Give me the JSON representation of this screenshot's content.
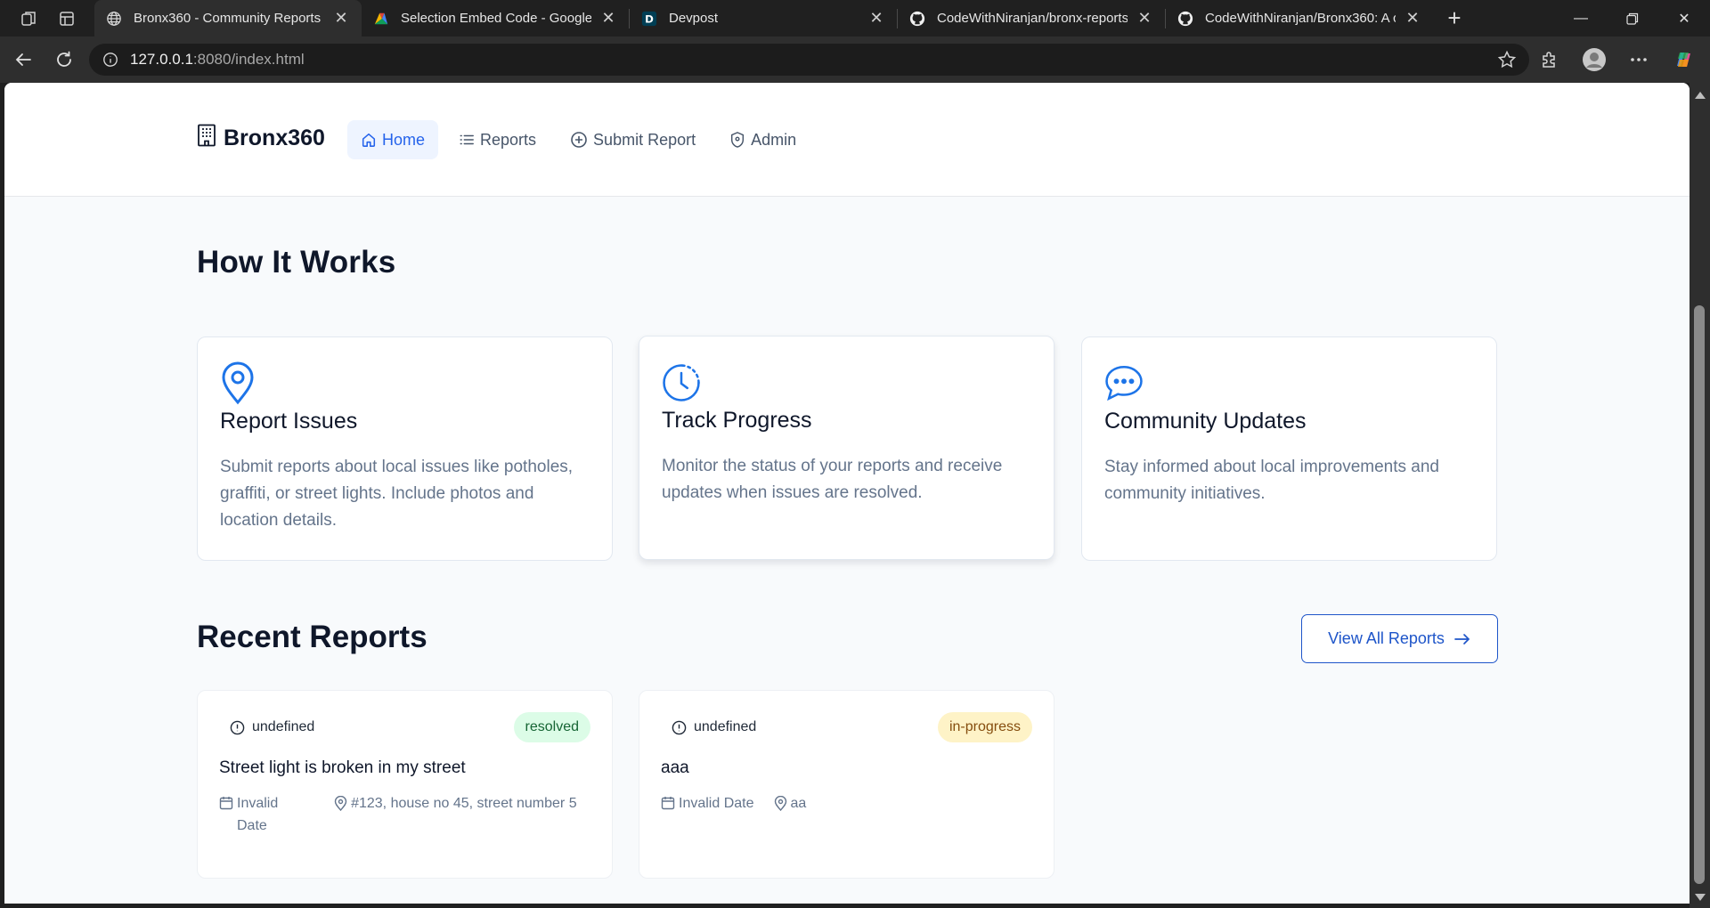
{
  "browser": {
    "tabs": [
      {
        "title": "Bronx360 - Community Reports",
        "favicon": "globe-icon",
        "active": true
      },
      {
        "title": "Selection Embed Code - Google F",
        "favicon": "multicolor-logo-icon",
        "active": false
      },
      {
        "title": "Devpost",
        "favicon": "devpost-d-icon",
        "active": false
      },
      {
        "title": "CodeWithNiranjan/bronx-reports",
        "favicon": "github-icon",
        "active": false
      },
      {
        "title": "CodeWithNiranjan/Bronx360: A co",
        "favicon": "github-icon",
        "active": false
      }
    ],
    "url_host": "127.0.0.1",
    "url_rest": ":8080/index.html"
  },
  "site": {
    "brand": "Bronx360",
    "nav": [
      {
        "label": "Home",
        "icon": "home-icon",
        "active": true
      },
      {
        "label": "Reports",
        "icon": "list-icon",
        "active": false
      },
      {
        "label": "Submit Report",
        "icon": "plus-circle-icon",
        "active": false
      },
      {
        "label": "Admin",
        "icon": "shield-icon",
        "active": false
      }
    ]
  },
  "how_it_works": {
    "heading": "How It Works",
    "features": [
      {
        "icon": "map-pin-icon",
        "title": "Report Issues",
        "text": "Submit reports about local issues like potholes, graffiti, or street lights. Include photos and location details."
      },
      {
        "icon": "clock-icon",
        "title": "Track Progress",
        "text": "Monitor the status of your reports and receive updates when issues are resolved."
      },
      {
        "icon": "chat-bubble-icon",
        "title": "Community Updates",
        "text": "Stay informed about local improvements and community initiatives."
      }
    ]
  },
  "recent": {
    "heading": "Recent Reports",
    "view_all_label": "View All Reports",
    "reports": [
      {
        "category": "undefined",
        "status": "resolved",
        "title": "Street light is broken in my street",
        "date": "Invalid Date",
        "location": "#123, house no 45, street number 5"
      },
      {
        "category": "undefined",
        "status": "in-progress",
        "title": "aaa",
        "date": "Invalid Date",
        "location": "aa"
      }
    ]
  },
  "colors": {
    "accent": "#2563eb",
    "resolved_bg": "#dcfce7",
    "in_progress_bg": "#fef3c7"
  }
}
